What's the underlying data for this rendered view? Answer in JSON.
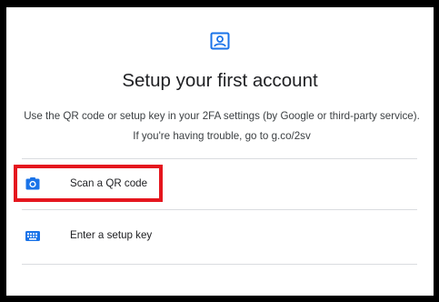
{
  "header": {
    "icon": "account-box-icon",
    "title": "Setup your first account",
    "description": "Use the QR code or setup key in your 2FA settings (by Google or third-party service). If you're having trouble, go to g.co/2sv"
  },
  "options": [
    {
      "label": "Scan a QR code",
      "icon": "camera-icon",
      "highlighted": true
    },
    {
      "label": "Enter a setup key",
      "icon": "keyboard-icon",
      "highlighted": false
    }
  ],
  "colors": {
    "accent": "#1a73e8",
    "highlight_border": "#e5161e",
    "divider": "#dadce0",
    "text_primary": "#202124",
    "text_secondary": "#3c4043"
  }
}
